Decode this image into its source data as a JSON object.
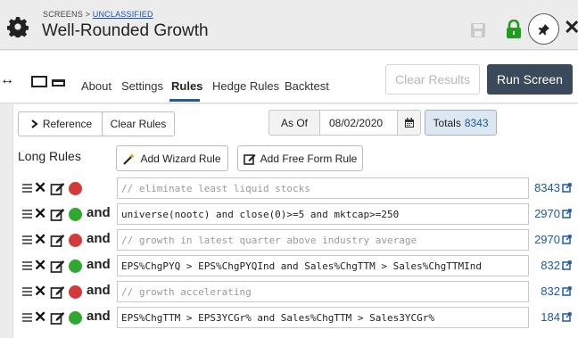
{
  "header": {
    "breadcrumb_prefix": "SCREENS > ",
    "breadcrumb_link": "UNCLASSIFIED",
    "title": "Well-Rounded Growth"
  },
  "tabs": [
    {
      "label": "About",
      "active": false
    },
    {
      "label": "Settings",
      "active": false
    },
    {
      "label": "Rules",
      "active": true
    },
    {
      "label": "Hedge Rules",
      "active": false
    },
    {
      "label": "Backtest",
      "active": false
    }
  ],
  "actions": {
    "clear_results": "Clear Results",
    "run_screen": "Run Screen"
  },
  "toolbar": {
    "reference": "Reference",
    "clear_rules": "Clear Rules",
    "as_of_label": "As Of",
    "as_of_date": "08/02/2020",
    "totals_label": "Totals",
    "totals_value": "8343"
  },
  "long_rules": {
    "heading": "Long Rules",
    "add_wizard": "Add Wizard Rule",
    "add_free_form": "Add Free Form Rule"
  },
  "rules": [
    {
      "status": "red",
      "connector": "",
      "text": "// eliminate least liquid stocks",
      "comment": true,
      "count": "8343"
    },
    {
      "status": "green",
      "connector": "and",
      "text": "universe(nootc) and close(0)>=5 and mktcap>=250",
      "comment": false,
      "count": "2970"
    },
    {
      "status": "red",
      "connector": "and",
      "text": "// growth in latest quarter above industry average",
      "comment": true,
      "count": "2970"
    },
    {
      "status": "green",
      "connector": "and",
      "text": "EPS%ChgPYQ > EPS%ChgPYQInd and Sales%ChgTTM > Sales%ChgTTMInd",
      "comment": false,
      "count": "832"
    },
    {
      "status": "red",
      "connector": "and",
      "text": "// growth accelerating",
      "comment": true,
      "count": "832"
    },
    {
      "status": "green",
      "connector": "and",
      "text": "EPS%ChgTTM > EPS3YCGr% and  Sales%ChgTTM > Sales3YCGr%",
      "comment": false,
      "count": "184"
    }
  ],
  "colors": {
    "accent": "#1d5aa6",
    "run_button": "#3a4a5a",
    "status_red": "#d33a3a",
    "status_green": "#2ea82e"
  }
}
